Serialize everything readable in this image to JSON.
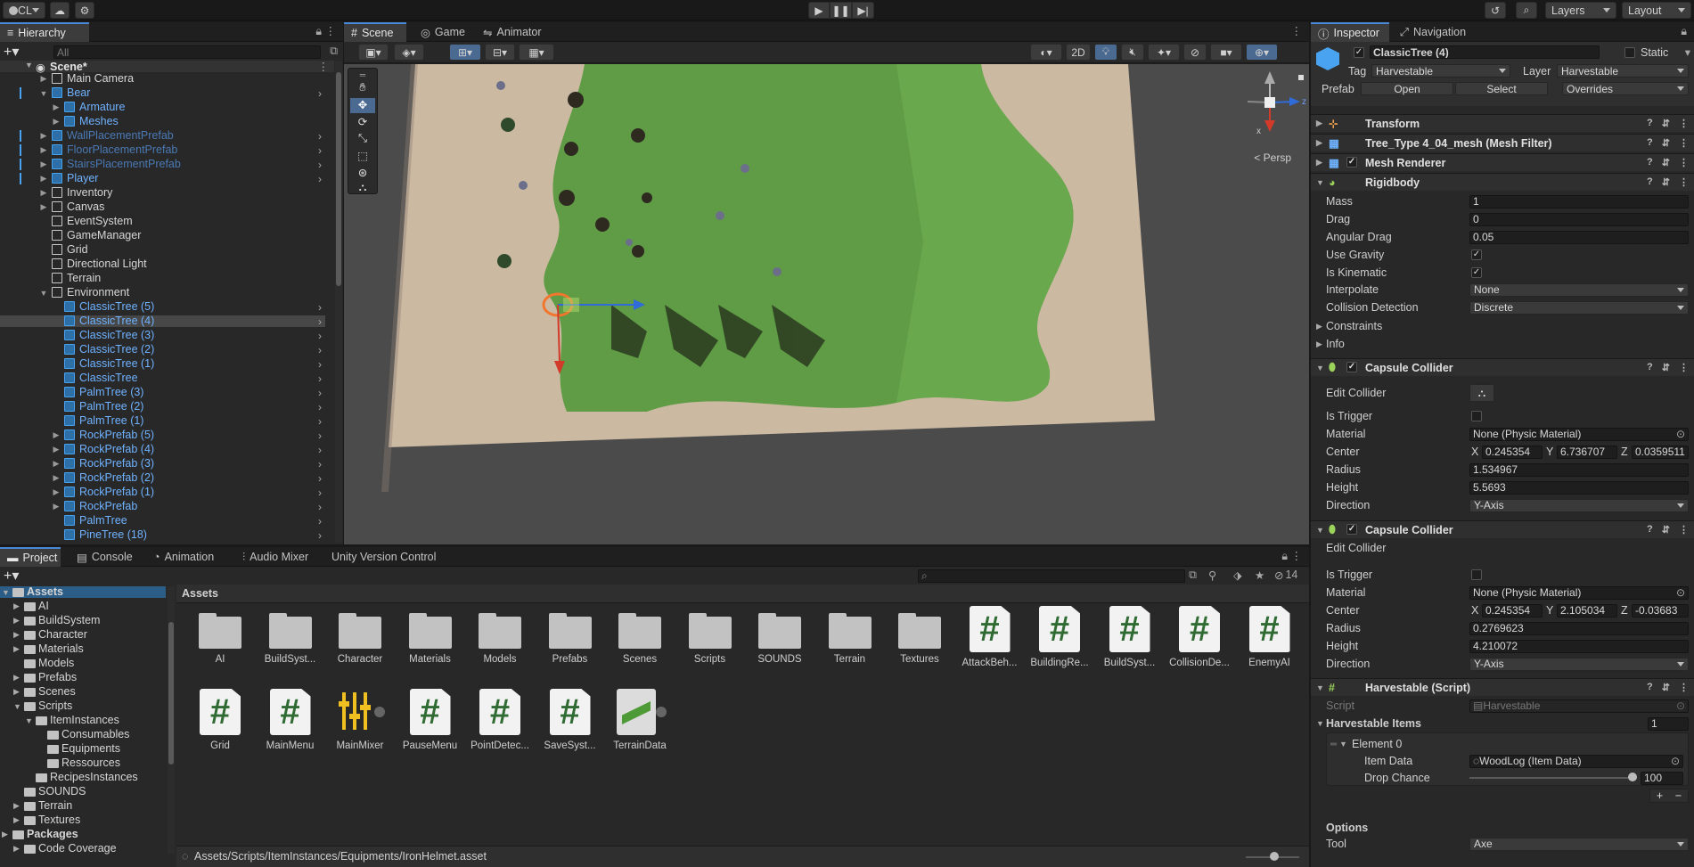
{
  "toolbar": {
    "account": "CL",
    "layers": "Layers",
    "layout": "Layout"
  },
  "hierarchy": {
    "tab": "Hierarchy",
    "search_placeholder": "All",
    "scene": "Scene*",
    "items": [
      {
        "label": "Main Camera",
        "style": "normal",
        "indent": 1,
        "arrow": "▶",
        "chevron": false
      },
      {
        "label": "Bear",
        "style": "blue",
        "indent": 1,
        "arrow": "▼",
        "chevron": true
      },
      {
        "label": "Armature",
        "style": "blue",
        "indent": 2,
        "arrow": "▶",
        "chevron": false
      },
      {
        "label": "Meshes",
        "style": "blue",
        "indent": 2,
        "arrow": "▶",
        "chevron": false
      },
      {
        "label": "WallPlacementPrefab",
        "style": "faded",
        "indent": 1,
        "arrow": "▶",
        "chevron": true
      },
      {
        "label": "FloorPlacementPrefab",
        "style": "faded",
        "indent": 1,
        "arrow": "▶",
        "chevron": true
      },
      {
        "label": "StairsPlacementPrefab",
        "style": "faded",
        "indent": 1,
        "arrow": "▶",
        "chevron": true
      },
      {
        "label": "Player",
        "style": "blue",
        "indent": 1,
        "arrow": "▶",
        "chevron": true
      },
      {
        "label": "Inventory",
        "style": "normal",
        "indent": 1,
        "arrow": "▶",
        "chevron": false
      },
      {
        "label": "Canvas",
        "style": "normal",
        "indent": 1,
        "arrow": "▶",
        "chevron": false
      },
      {
        "label": "EventSystem",
        "style": "normal",
        "indent": 1,
        "arrow": "",
        "chevron": false
      },
      {
        "label": "GameManager",
        "style": "normal",
        "indent": 1,
        "arrow": "",
        "chevron": false
      },
      {
        "label": "Grid",
        "style": "normal",
        "indent": 1,
        "arrow": "",
        "chevron": false
      },
      {
        "label": "Directional Light",
        "style": "normal",
        "indent": 1,
        "arrow": "",
        "chevron": false
      },
      {
        "label": "Terrain",
        "style": "normal",
        "indent": 1,
        "arrow": "",
        "chevron": false
      },
      {
        "label": "Environment",
        "style": "normal",
        "indent": 1,
        "arrow": "▼",
        "chevron": false
      },
      {
        "label": "ClassicTree (5)",
        "style": "blue",
        "indent": 2,
        "arrow": "",
        "chevron": true
      },
      {
        "label": "ClassicTree (4)",
        "style": "blue",
        "indent": 2,
        "arrow": "",
        "chevron": true,
        "selected": true
      },
      {
        "label": "ClassicTree (3)",
        "style": "blue",
        "indent": 2,
        "arrow": "",
        "chevron": true
      },
      {
        "label": "ClassicTree (2)",
        "style": "blue",
        "indent": 2,
        "arrow": "",
        "chevron": true
      },
      {
        "label": "ClassicTree (1)",
        "style": "blue",
        "indent": 2,
        "arrow": "",
        "chevron": true
      },
      {
        "label": "ClassicTree",
        "style": "blue",
        "indent": 2,
        "arrow": "",
        "chevron": true
      },
      {
        "label": "PalmTree (3)",
        "style": "blue",
        "indent": 2,
        "arrow": "",
        "chevron": true
      },
      {
        "label": "PalmTree (2)",
        "style": "blue",
        "indent": 2,
        "arrow": "",
        "chevron": true
      },
      {
        "label": "PalmTree (1)",
        "style": "blue",
        "indent": 2,
        "arrow": "",
        "chevron": true
      },
      {
        "label": "RockPrefab (5)",
        "style": "blue",
        "indent": 2,
        "arrow": "▶",
        "chevron": true
      },
      {
        "label": "RockPrefab (4)",
        "style": "blue",
        "indent": 2,
        "arrow": "▶",
        "chevron": true
      },
      {
        "label": "RockPrefab (3)",
        "style": "blue",
        "indent": 2,
        "arrow": "▶",
        "chevron": true
      },
      {
        "label": "RockPrefab (2)",
        "style": "blue",
        "indent": 2,
        "arrow": "▶",
        "chevron": true
      },
      {
        "label": "RockPrefab (1)",
        "style": "blue",
        "indent": 2,
        "arrow": "▶",
        "chevron": true
      },
      {
        "label": "RockPrefab",
        "style": "blue",
        "indent": 2,
        "arrow": "▶",
        "chevron": true
      },
      {
        "label": "PalmTree",
        "style": "blue",
        "indent": 2,
        "arrow": "",
        "chevron": true
      },
      {
        "label": "PineTree (18)",
        "style": "blue",
        "indent": 2,
        "arrow": "",
        "chevron": true
      }
    ]
  },
  "scene_view": {
    "tabs": [
      "Scene",
      "Game",
      "Animator"
    ],
    "mode_2d": "2D",
    "persp": "< Persp",
    "gizmo_x": "x",
    "gizmo_z": "z"
  },
  "inspector": {
    "tabs": [
      "Inspector",
      "Navigation"
    ],
    "object_name": "ClassicTree (4)",
    "static_label": "Static",
    "tag_label": "Tag",
    "tag_value": "Harvestable",
    "layer_label": "Layer",
    "layer_value": "Harvestable",
    "prefab_label": "Prefab",
    "prefab_open": "Open",
    "prefab_select": "Select",
    "prefab_overrides": "Overrides",
    "components": {
      "transform": "Transform",
      "mesh_filter": "Tree_Type 4_04_mesh (Mesh Filter)",
      "mesh_renderer": "Mesh Renderer",
      "rigidbody": "Rigidbody"
    },
    "rigidbody": {
      "mass_label": "Mass",
      "mass": "1",
      "drag_label": "Drag",
      "drag": "0",
      "angular_drag_label": "Angular Drag",
      "angular_drag": "0.05",
      "use_gravity_label": "Use Gravity",
      "is_kinematic_label": "Is Kinematic",
      "interpolate_label": "Interpolate",
      "interpolate": "None",
      "collision_label": "Collision Detection",
      "collision": "Discrete",
      "constraints_label": "Constraints",
      "info_label": "Info"
    },
    "capsule1": {
      "title": "Capsule Collider",
      "edit_label": "Edit Collider",
      "trigger_label": "Is Trigger",
      "material_label": "Material",
      "material": "None (Physic Material)",
      "center_label": "Center",
      "cx": "0.245354",
      "cy": "6.736707",
      "cz": "0.0359511",
      "radius_label": "Radius",
      "radius": "1.534967",
      "height_label": "Height",
      "height": "5.5693",
      "direction_label": "Direction",
      "direction": "Y-Axis"
    },
    "capsule2": {
      "title": "Capsule Collider",
      "edit_label": "Edit Collider",
      "trigger_label": "Is Trigger",
      "material_label": "Material",
      "material": "None (Physic Material)",
      "center_label": "Center",
      "cx": "0.245354",
      "cy": "2.105034",
      "cz": "-0.03683",
      "radius_label": "Radius",
      "radius": "0.2769623",
      "height_label": "Height",
      "height": "4.210072",
      "direction_label": "Direction",
      "direction": "Y-Axis"
    },
    "harvestable": {
      "title": "Harvestable (Script)",
      "script_label": "Script",
      "script": "Harvestable",
      "items_label": "Harvestable Items",
      "items_count": "1",
      "element_label": "Element 0",
      "item_data_label": "Item Data",
      "item_data": "WoodLog (Item Data)",
      "drop_chance_label": "Drop Chance",
      "drop_chance": "100",
      "options_label": "Options",
      "tool_label": "Tool",
      "tool": "Axe"
    },
    "axis_x": "X",
    "axis_y": "Y",
    "axis_z": "Z"
  },
  "project": {
    "tabs": [
      "Project",
      "Console",
      "Animation",
      "Audio Mixer",
      "Unity Version Control"
    ],
    "hidden_count": "14",
    "breadcrumb": "Assets",
    "path": "Assets/Scripts/ItemInstances/Equipments/IronHelmet.asset",
    "tree": [
      {
        "label": "Assets",
        "indent": 0,
        "arrow": "▼",
        "bold": true,
        "selected": true
      },
      {
        "label": "AI",
        "indent": 1,
        "arrow": "▶"
      },
      {
        "label": "BuildSystem",
        "indent": 1,
        "arrow": "▶"
      },
      {
        "label": "Character",
        "indent": 1,
        "arrow": "▶"
      },
      {
        "label": "Materials",
        "indent": 1,
        "arrow": "▶"
      },
      {
        "label": "Models",
        "indent": 1,
        "arrow": ""
      },
      {
        "label": "Prefabs",
        "indent": 1,
        "arrow": "▶"
      },
      {
        "label": "Scenes",
        "indent": 1,
        "arrow": "▶"
      },
      {
        "label": "Scripts",
        "indent": 1,
        "arrow": "▼"
      },
      {
        "label": "ItemInstances",
        "indent": 2,
        "arrow": "▼"
      },
      {
        "label": "Consumables",
        "indent": 3,
        "arrow": ""
      },
      {
        "label": "Equipments",
        "indent": 3,
        "arrow": ""
      },
      {
        "label": "Ressources",
        "indent": 3,
        "arrow": ""
      },
      {
        "label": "RecipesInstances",
        "indent": 2,
        "arrow": ""
      },
      {
        "label": "SOUNDS",
        "indent": 1,
        "arrow": ""
      },
      {
        "label": "Terrain",
        "indent": 1,
        "arrow": "▶"
      },
      {
        "label": "Textures",
        "indent": 1,
        "arrow": "▶"
      },
      {
        "label": "Packages",
        "indent": 0,
        "arrow": "▶",
        "bold": true
      },
      {
        "label": "Code Coverage",
        "indent": 1,
        "arrow": "▶"
      }
    ],
    "assets_row1": [
      {
        "label": "AI",
        "kind": "folder"
      },
      {
        "label": "BuildSyst...",
        "kind": "folder"
      },
      {
        "label": "Character",
        "kind": "folder"
      },
      {
        "label": "Materials",
        "kind": "folder"
      },
      {
        "label": "Models",
        "kind": "folder"
      },
      {
        "label": "Prefabs",
        "kind": "folder"
      },
      {
        "label": "Scenes",
        "kind": "folder"
      },
      {
        "label": "Scripts",
        "kind": "folder"
      },
      {
        "label": "SOUNDS",
        "kind": "folder"
      },
      {
        "label": "Terrain",
        "kind": "folder"
      },
      {
        "label": "Textures",
        "kind": "folder"
      },
      {
        "label": "AttackBeh...",
        "kind": "script"
      },
      {
        "label": "BuildingRe...",
        "kind": "script"
      },
      {
        "label": "BuildSyst...",
        "kind": "script"
      },
      {
        "label": "CollisionDe...",
        "kind": "script"
      },
      {
        "label": "EnemyAI",
        "kind": "script"
      }
    ],
    "assets_row2": [
      {
        "label": "Grid",
        "kind": "script"
      },
      {
        "label": "MainMenu",
        "kind": "script"
      },
      {
        "label": "MainMixer",
        "kind": "mixer"
      },
      {
        "label": "PauseMenu",
        "kind": "script"
      },
      {
        "label": "PointDetec...",
        "kind": "script"
      },
      {
        "label": "SaveSyst...",
        "kind": "script"
      },
      {
        "label": "TerrainData",
        "kind": "terrain"
      }
    ]
  },
  "colors": {
    "accent": "#4a89d8",
    "prefab_blue": "#6fb2ff",
    "grass": "#4f8a3a",
    "sand": "#cdb9a0"
  }
}
